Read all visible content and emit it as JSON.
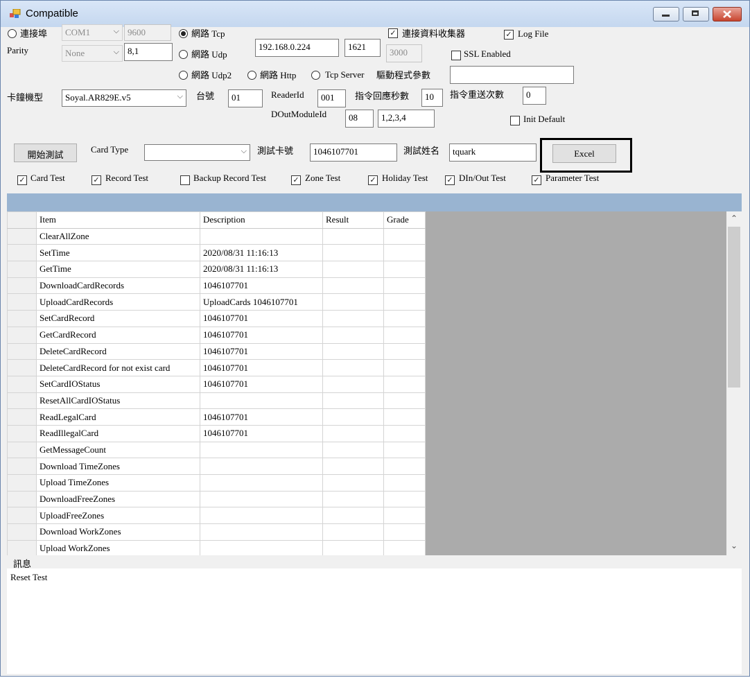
{
  "window": {
    "title": "Compatible"
  },
  "connection": {
    "serial_label": "連接埠",
    "com_port": "COM1",
    "baud": "9600",
    "parity_label": "Parity",
    "parity_value": "None",
    "data_bits": "8,1",
    "tcp_label": "網路 Tcp",
    "udp_label": "網路 Udp",
    "udp2_label": "網路 Udp2",
    "http_label": "網路 Http",
    "tcp_server_label": "Tcp Server",
    "ip_address": "192.168.0.224",
    "port": "1621",
    "port2": "3000",
    "collector_label": "連接資料收集器",
    "logfile_label": "Log File",
    "ssl_label": "SSL Enabled",
    "driver_param_label": "驅動程式參數",
    "driver_param_value": ""
  },
  "device": {
    "model_label": "卡鐘機型",
    "model_value": "Soyal.AR829E.v5",
    "station_label": "台號",
    "station_value": "01",
    "reader_id_label": "ReaderId",
    "reader_id_value": "001",
    "response_sec_label": "指令回應秒數",
    "response_sec_value": "10",
    "retry_label": "指令重送次數",
    "retry_value": "0",
    "dout_module_label": "DOutModuleId",
    "dout_module_value": "08",
    "dout_list_value": "1,2,3,4",
    "init_default_label": "Init Default"
  },
  "test": {
    "start_button": "開始測試",
    "card_type_label": "Card Type",
    "card_type_value": "",
    "card_no_label": "測試卡號",
    "card_no_value": "1046107701",
    "name_label": "測試姓名",
    "name_value": "tquark",
    "excel_button": "Excel",
    "options": [
      {
        "label": "Card Test",
        "checked": true
      },
      {
        "label": "Record Test",
        "checked": true
      },
      {
        "label": "Backup Record Test",
        "checked": false
      },
      {
        "label": "Zone Test",
        "checked": true
      },
      {
        "label": "Holiday Test",
        "checked": true
      },
      {
        "label": "DIn/Out Test",
        "checked": true
      },
      {
        "label": "Parameter Test",
        "checked": true
      }
    ]
  },
  "grid": {
    "columns": [
      "Item",
      "Description",
      "Result",
      "Grade"
    ],
    "rows": [
      [
        "ClearAllZone",
        "",
        "",
        ""
      ],
      [
        "SetTime",
        "2020/08/31 11:16:13",
        "",
        ""
      ],
      [
        "GetTime",
        "2020/08/31 11:16:13",
        "",
        ""
      ],
      [
        "DownloadCardRecords",
        "1046107701",
        "",
        ""
      ],
      [
        "UploadCardRecords",
        "UploadCards 1046107701",
        "",
        ""
      ],
      [
        "SetCardRecord",
        "1046107701",
        "",
        ""
      ],
      [
        "GetCardRecord",
        "1046107701",
        "",
        ""
      ],
      [
        "DeleteCardRecord",
        "1046107701",
        "",
        ""
      ],
      [
        "DeleteCardRecord for not exist card",
        "1046107701",
        "",
        ""
      ],
      [
        "SetCardIOStatus",
        "1046107701",
        "",
        ""
      ],
      [
        "ResetAllCardIOStatus",
        "",
        "",
        ""
      ],
      [
        "ReadLegalCard",
        "1046107701",
        "",
        ""
      ],
      [
        "ReadIllegalCard",
        "1046107701",
        "",
        ""
      ],
      [
        "GetMessageCount",
        "",
        "",
        ""
      ],
      [
        "Download TimeZones",
        "",
        "",
        ""
      ],
      [
        "Upload TimeZones",
        "",
        "",
        ""
      ],
      [
        "DownloadFreeZones",
        "",
        "",
        ""
      ],
      [
        "UploadFreeZones",
        "",
        "",
        ""
      ],
      [
        "Download WorkZones",
        "",
        "",
        ""
      ],
      [
        "Upload WorkZones",
        "",
        "",
        ""
      ]
    ]
  },
  "message": {
    "label": "訊息",
    "text": "Reset Test"
  }
}
